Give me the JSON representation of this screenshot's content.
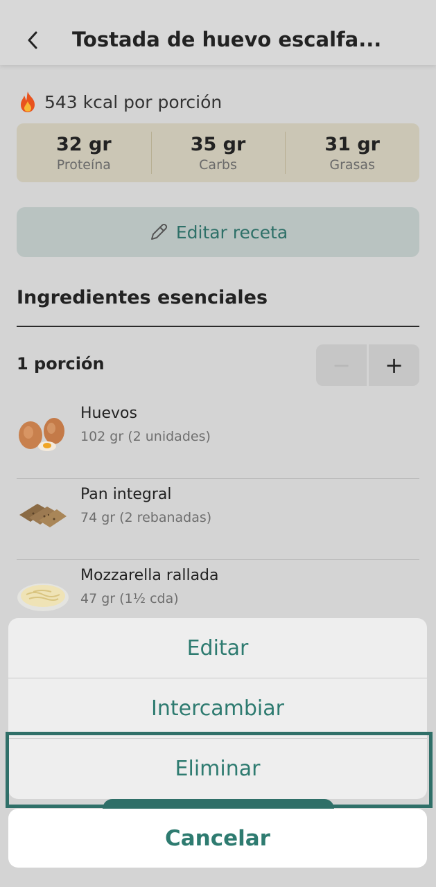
{
  "header": {
    "title": "Tostada de huevo escalfa..."
  },
  "kcal": {
    "text": "543 kcal por porción"
  },
  "macros": [
    {
      "value": "32 gr",
      "label": "Proteína"
    },
    {
      "value": "35 gr",
      "label": "Carbs"
    },
    {
      "value": "31 gr",
      "label": "Grasas"
    }
  ],
  "edit_recipe": {
    "label": "Editar receta"
  },
  "ingredients_section": {
    "title": "Ingredientes esenciales",
    "portion": "1 porción",
    "stepper": {
      "minus": "−",
      "plus": "+"
    },
    "items": [
      {
        "name": "Huevos",
        "quantity": "102 gr (2 unidades)",
        "icon": "eggs-image"
      },
      {
        "name": "Pan integral",
        "quantity": "74 gr (2 rebanadas)",
        "icon": "bread-image"
      },
      {
        "name": "Mozzarella rallada",
        "quantity": "47 gr (1½ cda)",
        "icon": "mozzarella-image"
      }
    ]
  },
  "action_sheet": {
    "items": [
      "Editar",
      "Intercambiar",
      "Eliminar"
    ],
    "cancel": "Cancelar"
  },
  "colors": {
    "accent": "#2e7b70",
    "highlight": "#2f6f68",
    "macro_bg": "#cbc6b5",
    "edit_bg": "#b9c3c1"
  }
}
